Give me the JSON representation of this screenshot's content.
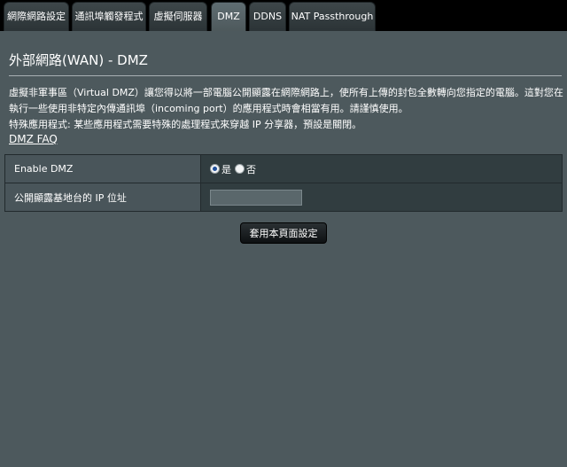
{
  "tabs": [
    {
      "label": "網際網路設定",
      "active": false
    },
    {
      "label": "通訊埠觸發程式",
      "active": false
    },
    {
      "label": "虛擬伺服器",
      "active": false
    },
    {
      "label": "DMZ",
      "active": true
    },
    {
      "label": "DDNS",
      "active": false
    },
    {
      "label": "NAT Passthrough",
      "active": false
    }
  ],
  "page": {
    "title": "外部網路(WAN) - DMZ",
    "description": [
      "虛擬非軍事區（Virtual DMZ）讓您得以將一部電腦公開顯露在網際網路上，使所有上傳的封包全數轉向您指定的電腦。這對您在",
      "執行一些使用非特定內傳通訊埠（incoming port）的應用程式時會相當有用。請謹慎使用。",
      "特殊應用程式: 某些應用程式需要特殊的處理程式來穿越 IP 分享器，預設是關閉。"
    ],
    "faq_link": "DMZ FAQ"
  },
  "settings": {
    "enable_dmz": {
      "label": "Enable DMZ",
      "options": [
        "是",
        "否"
      ],
      "selected": "是"
    },
    "exposed_ip": {
      "label": "公開顯露基地台的 IP 位址",
      "value": ""
    }
  },
  "apply_button": "套用本頁面設定",
  "colors": {
    "page_background": "#4d595d",
    "tab_bar": "#000000",
    "table_value_cell": "#313d40"
  }
}
